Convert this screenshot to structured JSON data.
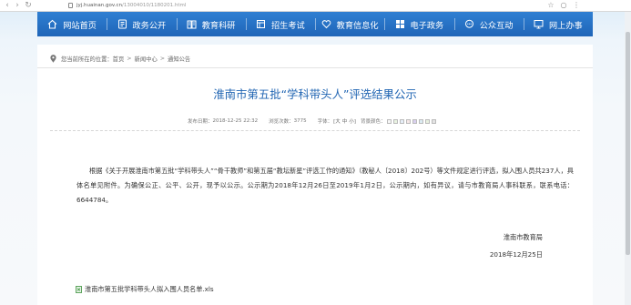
{
  "browser": {
    "url_domain": "jyj.huainan.gov.cn",
    "url_path": "/13004010/1180201.html"
  },
  "nav": {
    "items": [
      {
        "label": "网站首页",
        "icon": "home-icon"
      },
      {
        "label": "政务公开",
        "icon": "list-icon"
      },
      {
        "label": "教育科研",
        "icon": "book-icon"
      },
      {
        "label": "招生考试",
        "icon": "exam-icon"
      },
      {
        "label": "教育信息化",
        "icon": "heart-icon"
      },
      {
        "label": "电子政务",
        "icon": "grid-icon"
      },
      {
        "label": "公众互动",
        "icon": "chat-icon"
      },
      {
        "label": "网上办事",
        "icon": "monitor-icon"
      }
    ]
  },
  "breadcrumb": {
    "prefix": "您当前所在的位置：",
    "items": [
      "首页",
      "新闻中心",
      "通知公告"
    ],
    "separator": ">"
  },
  "article": {
    "title": "淮南市第五批“学科带头人”评选结果公示",
    "meta": {
      "published_label": "发布日期：",
      "published": "2018-12-25 22:32",
      "views_label": "浏览次数：",
      "views": "3775",
      "font_label": "字体：",
      "font_sizes": [
        "[大",
        "中",
        "小]"
      ],
      "bg_label": "背景颜色：",
      "bg_colors": [
        "#f7f7f7",
        "#e9f3e2",
        "#e6eef8",
        "#f6e8e8",
        "#d9d0ef",
        "#dcecf3",
        "#e8f1e0",
        "#e4e4e4"
      ]
    },
    "body": "根据《关于开展淮南市第五批“学科带头人”“骨干教师”和第五届“教坛新星”评选工作的通知》（教秘人〔2018〕202号）等文件规定进行评选，拟入围人员共237人，具体名单见附件。为确保公正、公平、公开，现予以公示。公示期为2018年12月26日至2019年1月2日，公示期内，如有异议，请与市教育局人事科联系，联系电话：6644784。",
    "signature_org": "淮南市教育局",
    "signature_date": "2018年12月25日",
    "attachment": "淮南市第五批学科带头人拟入围人员名单.xls"
  },
  "colors": {
    "nav_bg": "#2570c4",
    "title": "#2266b3",
    "page_bg": "#e8f1f9"
  }
}
